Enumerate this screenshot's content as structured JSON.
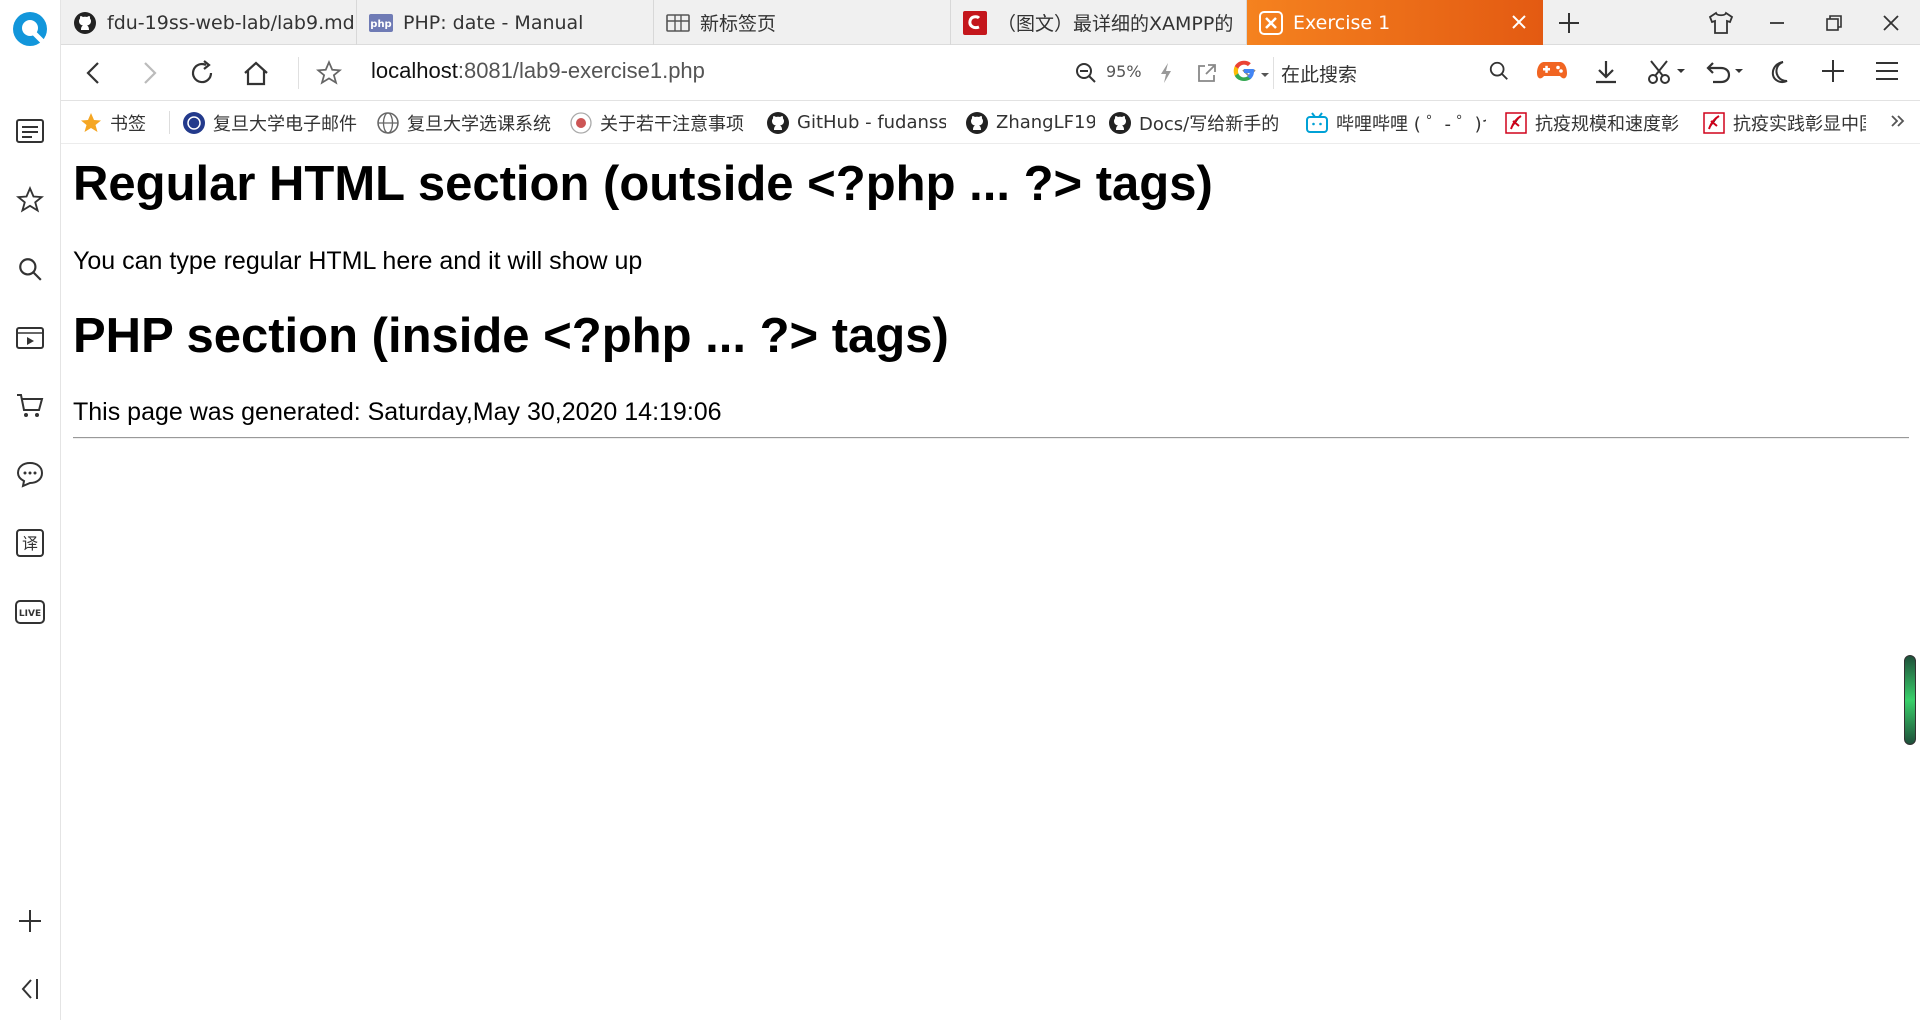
{
  "tabs": [
    {
      "label": "fdu-19ss-web-lab/lab9.md",
      "icon": "github-icon"
    },
    {
      "label": "PHP: date - Manual",
      "icon": "php-icon"
    },
    {
      "label": "新标签页",
      "icon": "newtab-icon"
    },
    {
      "label": "（图文）最详细的XAMPP的",
      "icon": "csdn-icon"
    },
    {
      "label": "Exercise 1",
      "icon": "xampp-icon",
      "active": true
    }
  ],
  "address": {
    "host": "localhost",
    "path": ":8081/lab9-exercise1.php"
  },
  "zoom": "95%",
  "search": {
    "placeholder": "在此搜索"
  },
  "bookmarks": [
    {
      "label": "书签",
      "icon": "star-icon"
    },
    {
      "label": "复旦大学电子邮件",
      "icon": "fudan-icon"
    },
    {
      "label": "复旦大学选课系统",
      "icon": "globe-icon"
    },
    {
      "label": "关于若干注意事项",
      "icon": "fudan-icon"
    },
    {
      "label": "GitHub - fudanss",
      "icon": "github-icon"
    },
    {
      "label": "ZhangLF19",
      "icon": "github-icon"
    },
    {
      "label": "Docs/写给新手的",
      "icon": "github-icon"
    },
    {
      "label": "哔哩哔哩 ( ゜- ゜)つ",
      "icon": "bilibili-icon"
    },
    {
      "label": "抗疫规模和速度彰",
      "icon": "news-icon"
    },
    {
      "label": "抗疫实践彰显中国",
      "icon": "news-icon"
    }
  ],
  "page": {
    "heading1": "Regular HTML section (outside <?php ... ?> tags)",
    "para1": "You can type regular HTML here and it will show up",
    "heading2": "PHP section (inside <?php ... ?> tags)",
    "para2": "This page was generated: Saturday,May 30,2020 14:19:06"
  },
  "colors": {
    "accent": "#f5821f",
    "brand_blue": "#1296db"
  }
}
